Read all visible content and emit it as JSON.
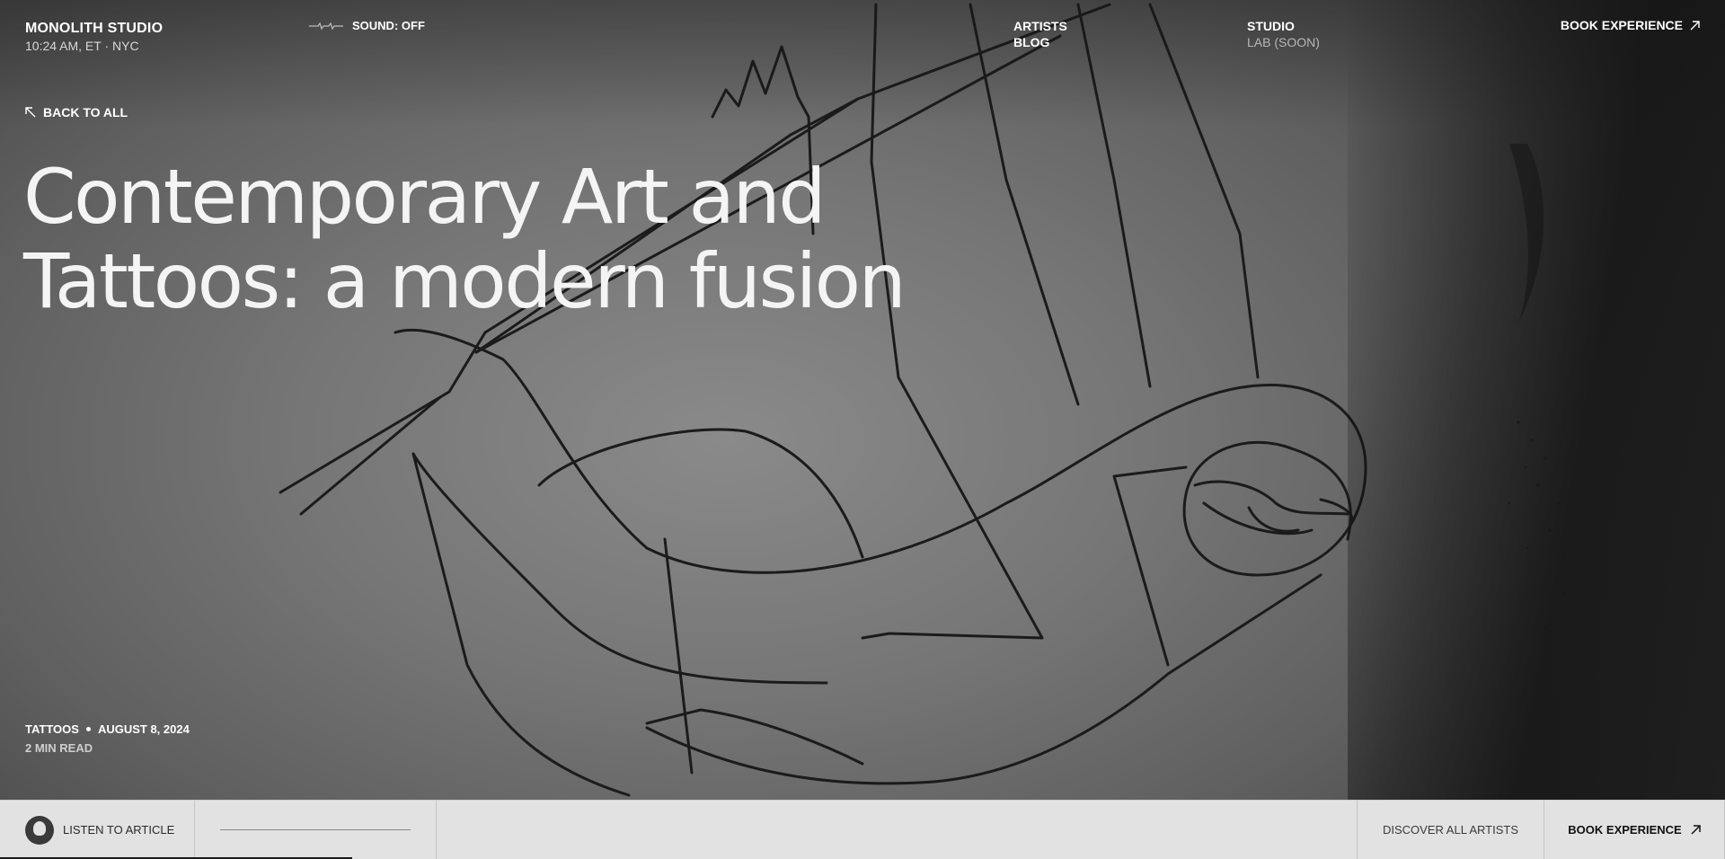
{
  "brand": {
    "name": "MONOLITH STUDIO",
    "time": "10:24 AM, ET · NYC"
  },
  "sound": {
    "label": "SOUND: OFF",
    "icon": "waveform-icon"
  },
  "nav": {
    "artists": "ARTISTS",
    "blog": "BLOG",
    "studio": "STUDIO",
    "lab": "LAB (SOON)"
  },
  "header": {
    "book": "BOOK EXPERIENCE",
    "book_icon": "arrow-up-right-icon"
  },
  "back": {
    "label": "BACK TO ALL",
    "icon": "arrow-up-left-icon"
  },
  "article": {
    "title_line1": "Contemporary Art and",
    "title_line2": "Tattoos: a modern fusion",
    "category": "TATTOOS",
    "date": "AUGUST 8, 2024",
    "read_time": "2 MIN READ"
  },
  "footer_bar": {
    "listen": "LISTEN TO ARTICLE",
    "discover": "DISCOVER ALL ARTISTS",
    "book": "BOOK EXPERIENCE",
    "listen_progress": 0
  },
  "colors": {
    "bar_bg": "#e2e2e2",
    "text_light": "#f4f4f4",
    "text_dark": "#111111"
  }
}
